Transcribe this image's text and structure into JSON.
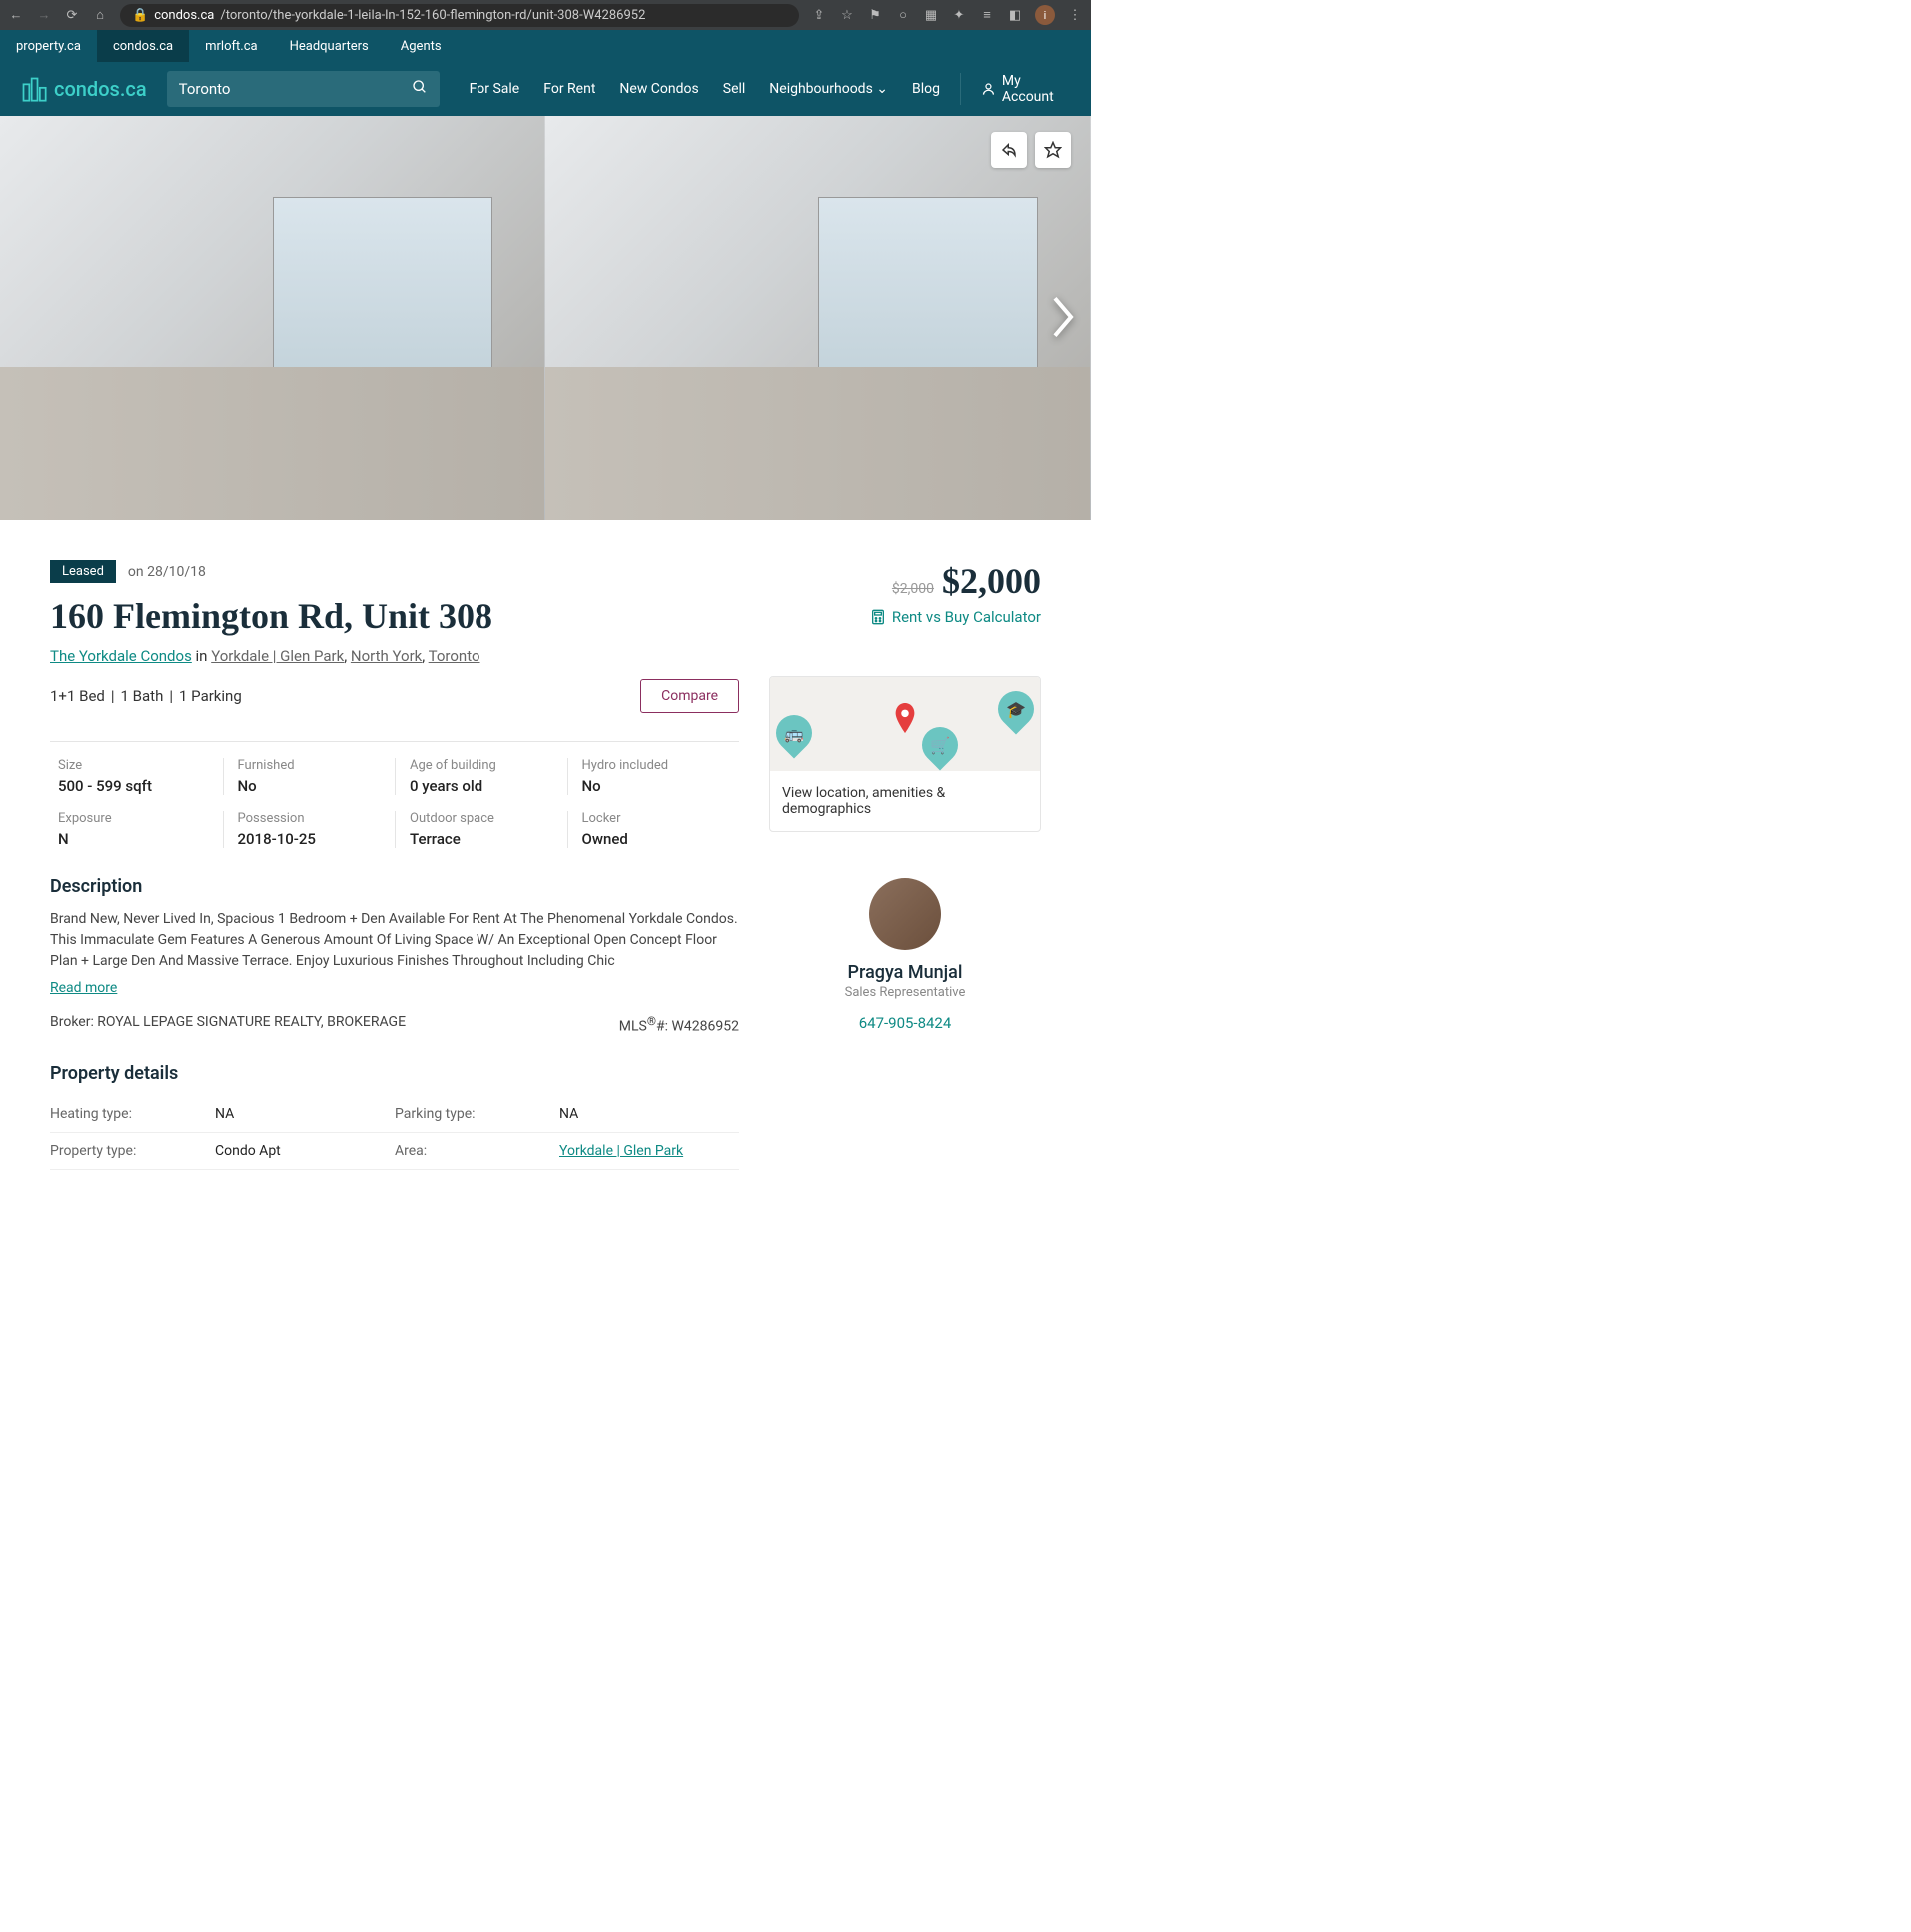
{
  "browser": {
    "url_prefix": "condos.ca",
    "url_path": "/toronto/the-yorkdale-1-leila-ln-152-160-flemington-rd/unit-308-W4286952"
  },
  "top_tabs": [
    "property.ca",
    "condos.ca",
    "mrloft.ca",
    "Headquarters",
    "Agents"
  ],
  "active_tab_index": 1,
  "logo_text": "condos.ca",
  "search_value": "Toronto",
  "nav": [
    "For Sale",
    "For Rent",
    "New Condos",
    "Sell",
    "Neighbourhoods",
    "Blog"
  ],
  "account_label": "My Account",
  "listing": {
    "status": "Leased",
    "status_date": "on 28/10/18",
    "title": "160 Flemington Rd, Unit 308",
    "building": "The Yorkdale Condos",
    "loc_in": " in ",
    "neighbourhood": "Yorkdale | Glen Park",
    "city": "North York",
    "province": "Toronto",
    "beds": "1+1 Bed",
    "baths": "1 Bath",
    "parking": "1 Parking",
    "compare": "Compare",
    "price_old": "$2,000",
    "price_new": "$2,000",
    "calc": "Rent vs Buy Calculator"
  },
  "facts": [
    {
      "label": "Size",
      "value": "500 - 599 sqft"
    },
    {
      "label": "Furnished",
      "value": "No"
    },
    {
      "label": "Age of building",
      "value": "0 years old"
    },
    {
      "label": "Hydro included",
      "value": "No"
    },
    {
      "label": "Exposure",
      "value": "N"
    },
    {
      "label": "Possession",
      "value": "2018-10-25"
    },
    {
      "label": "Outdoor space",
      "value": "Terrace"
    },
    {
      "label": "Locker",
      "value": "Owned"
    }
  ],
  "description": {
    "title": "Description",
    "text": "Brand New, Never Lived In, Spacious 1 Bedroom + Den Available For Rent At The Phenomenal Yorkdale Condos. This Immaculate Gem Features A Generous Amount Of Living Space W/ An Exceptional Open Concept Floor Plan + Large Den And Massive Terrace. Enjoy Luxurious Finishes Throughout Including Chic",
    "read_more": "Read more"
  },
  "broker_label": "Broker: ROYAL LEPAGE SIGNATURE REALTY, BROKERAGE",
  "mls_prefix": "MLS",
  "mls_suffix": "#: W4286952",
  "details": {
    "title": "Property details",
    "rows": [
      {
        "l1": "Heating type:",
        "v1": "NA",
        "l2": "Parking type:",
        "v2": "NA"
      },
      {
        "l1": "Property type:",
        "v1": "Condo Apt",
        "l2": "Area:",
        "v2": "Yorkdale | Glen Park",
        "v2link": true
      }
    ]
  },
  "map_caption": "View location, amenities & demographics",
  "agent": {
    "name": "Pragya Munjal",
    "role": "Sales Representative",
    "phone": "647-905-8424"
  }
}
